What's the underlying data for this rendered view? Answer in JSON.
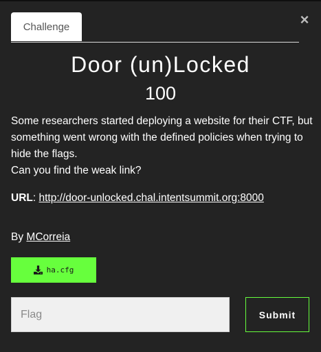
{
  "tabs": [
    {
      "label": "Challenge",
      "active": true
    }
  ],
  "close_label": "×",
  "challenge": {
    "title": "Door (un)Locked",
    "points": "100",
    "description": [
      "Some researchers started deploying a website for their CTF, but something went wrong with the defined policies when trying to hide the flags.",
      "Can you find the weak link?"
    ],
    "url_label": "URL",
    "url_separator": ":",
    "url": "http://door-unlocked.chal.intentsummit.org:8000",
    "author_prefix": "By",
    "author": "MCorreia",
    "file": {
      "name": "ha.cfg",
      "icon": "download-icon"
    }
  },
  "form": {
    "flag_placeholder": "Flag",
    "flag_value": "",
    "submit_label": "Submit"
  },
  "colors": {
    "background": "#232323",
    "accent": "#67ff3d",
    "tab_background": "#ffffff"
  }
}
